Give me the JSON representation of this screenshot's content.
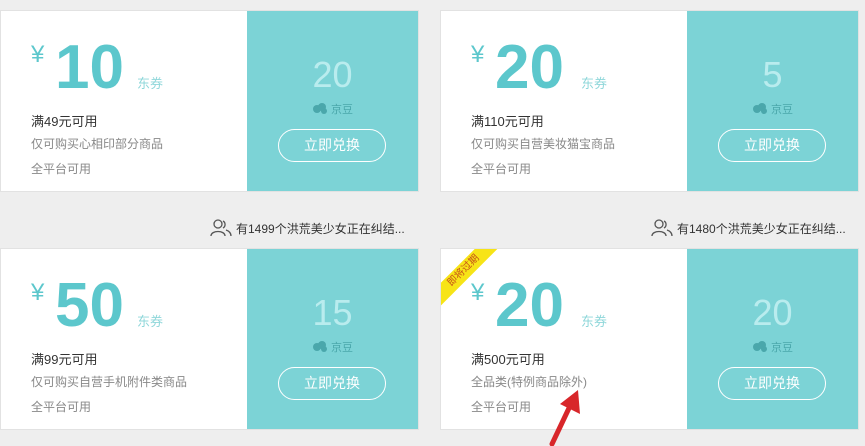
{
  "colors": {
    "accent": "#5cc7cc",
    "panel": "#7cd3d6",
    "ribbon": "#f7e417",
    "arrow": "#d8262a"
  },
  "coupons": [
    {
      "currency": "¥",
      "amount": "10",
      "unit": "东券",
      "condition": "满49元可用",
      "scope": "仅可购买心相印部分商品",
      "platform": "全平台可用",
      "price": "20",
      "price_unit": "京豆",
      "button": "立即兑换"
    },
    {
      "currency": "¥",
      "amount": "20",
      "unit": "东券",
      "condition": "满110元可用",
      "scope": "仅可购买自营美妆猫宝商品",
      "platform": "全平台可用",
      "price": "5",
      "price_unit": "京豆",
      "button": "立即兑换"
    },
    {
      "currency": "¥",
      "amount": "50",
      "unit": "东券",
      "condition": "满99元可用",
      "scope": "仅可购买自营手机附件类商品",
      "platform": "全平台可用",
      "price": "15",
      "price_unit": "京豆",
      "button": "立即兑换"
    },
    {
      "currency": "¥",
      "amount": "20",
      "unit": "东券",
      "condition": "满500元可用",
      "scope": "全品类(特例商品除外)",
      "platform": "全平台可用",
      "price": "20",
      "price_unit": "京豆",
      "button": "立即兑换",
      "ribbon": "即将过期"
    }
  ],
  "people_notices": [
    {
      "text": "有1499个洪荒美少女正在纠结..."
    },
    {
      "text": "有1480个洪荒美少女正在纠结..."
    }
  ]
}
